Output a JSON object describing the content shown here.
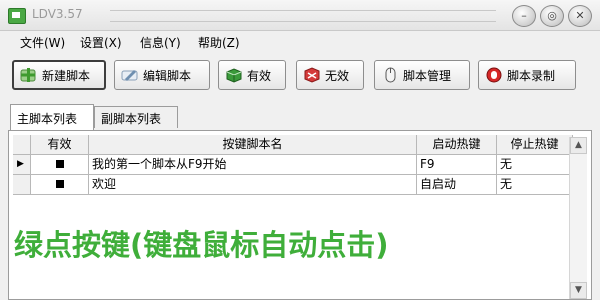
{
  "window": {
    "title": "LDV3.57",
    "buttons": {
      "minimize": "–",
      "restore": "◎",
      "close": "✕"
    }
  },
  "menu": [
    {
      "label": "文件(W)"
    },
    {
      "label": "设置(X)"
    },
    {
      "label": "信息(Y)"
    },
    {
      "label": "帮助(Z)"
    }
  ],
  "toolbar": {
    "new": "新建脚本",
    "edit": "编辑脚本",
    "enable": "有效",
    "disable": "无效",
    "manage": "脚本管理",
    "record": "脚本录制"
  },
  "tabs": {
    "main": "主脚本列表",
    "sub": "副脚本列表"
  },
  "table": {
    "columns": [
      "有效",
      "按键脚本名",
      "启动热键",
      "停止热键"
    ],
    "rows": [
      {
        "enabled": true,
        "name": "我的第一个脚本从F9开始",
        "start": "F9",
        "stop": "无",
        "current": true
      },
      {
        "enabled": true,
        "name": "欢迎",
        "start": "自启动",
        "stop": "无",
        "current": false
      }
    ]
  },
  "caption": "绿点按键(键盘鼠标自动点击)",
  "colors": {
    "caption": "#3fae3a",
    "app_icon": "#4aa844"
  }
}
